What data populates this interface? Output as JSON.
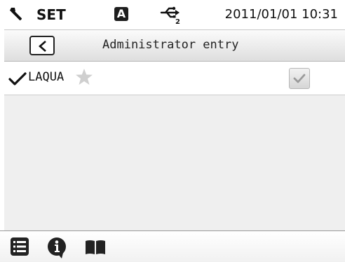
{
  "status_bar": {
    "mode_label": "SET",
    "badge_letter": "A",
    "datetime": "2011/01/01 10:31",
    "mode_icon": "wrench-icon",
    "connection_icon": "usb-icon"
  },
  "title_bar": {
    "title": "Administrator entry",
    "back_icon": "chevron-left-icon"
  },
  "list": {
    "items": [
      {
        "label": "LAQUA",
        "checked": true,
        "favorite": false
      }
    ]
  },
  "toolbar": {
    "icons": [
      "list-icon",
      "info-icon",
      "book-icon"
    ]
  },
  "colors": {
    "titlebar_gradient_top": "#fbfbfb",
    "titlebar_gradient_bottom": "#dedede",
    "empty_area": "#efefef",
    "star_gray": "#cfcfcf",
    "icon_dark": "#222222"
  }
}
